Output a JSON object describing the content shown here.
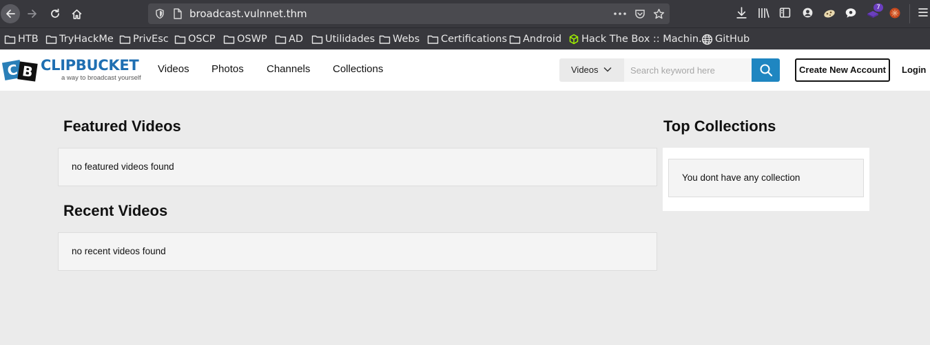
{
  "browser": {
    "url": "broadcast.vulnnet.thm",
    "extension_badge": "7",
    "bookmarks": [
      "HTB",
      "TryHackMe",
      "PrivEsc",
      "OSCP",
      "OSWP",
      "AD",
      "Utilidades",
      "Webs",
      "Certifications",
      "Android",
      "Hack The Box :: Machin...",
      "GitHub"
    ]
  },
  "site": {
    "logo_letters": [
      "C",
      "B"
    ],
    "logo_name": "CLIPBUCKET",
    "logo_tagline": "a way to broadcast yourself",
    "nav": [
      "Videos",
      "Photos",
      "Channels",
      "Collections"
    ],
    "search": {
      "type_label": "Videos",
      "placeholder": "Search keyword here"
    },
    "create_account": "Create New Account",
    "login": "Login"
  },
  "main": {
    "featured_title": "Featured Videos",
    "featured_empty": "no featured videos found",
    "recent_title": "Recent Videos",
    "recent_empty": "no recent videos found"
  },
  "sidebar": {
    "title": "Top Collections",
    "empty": "You dont have any collection"
  },
  "colors": {
    "brand_blue": "#1f86c1",
    "browser_chrome": "#38383d",
    "page_bg": "#ebebeb"
  }
}
